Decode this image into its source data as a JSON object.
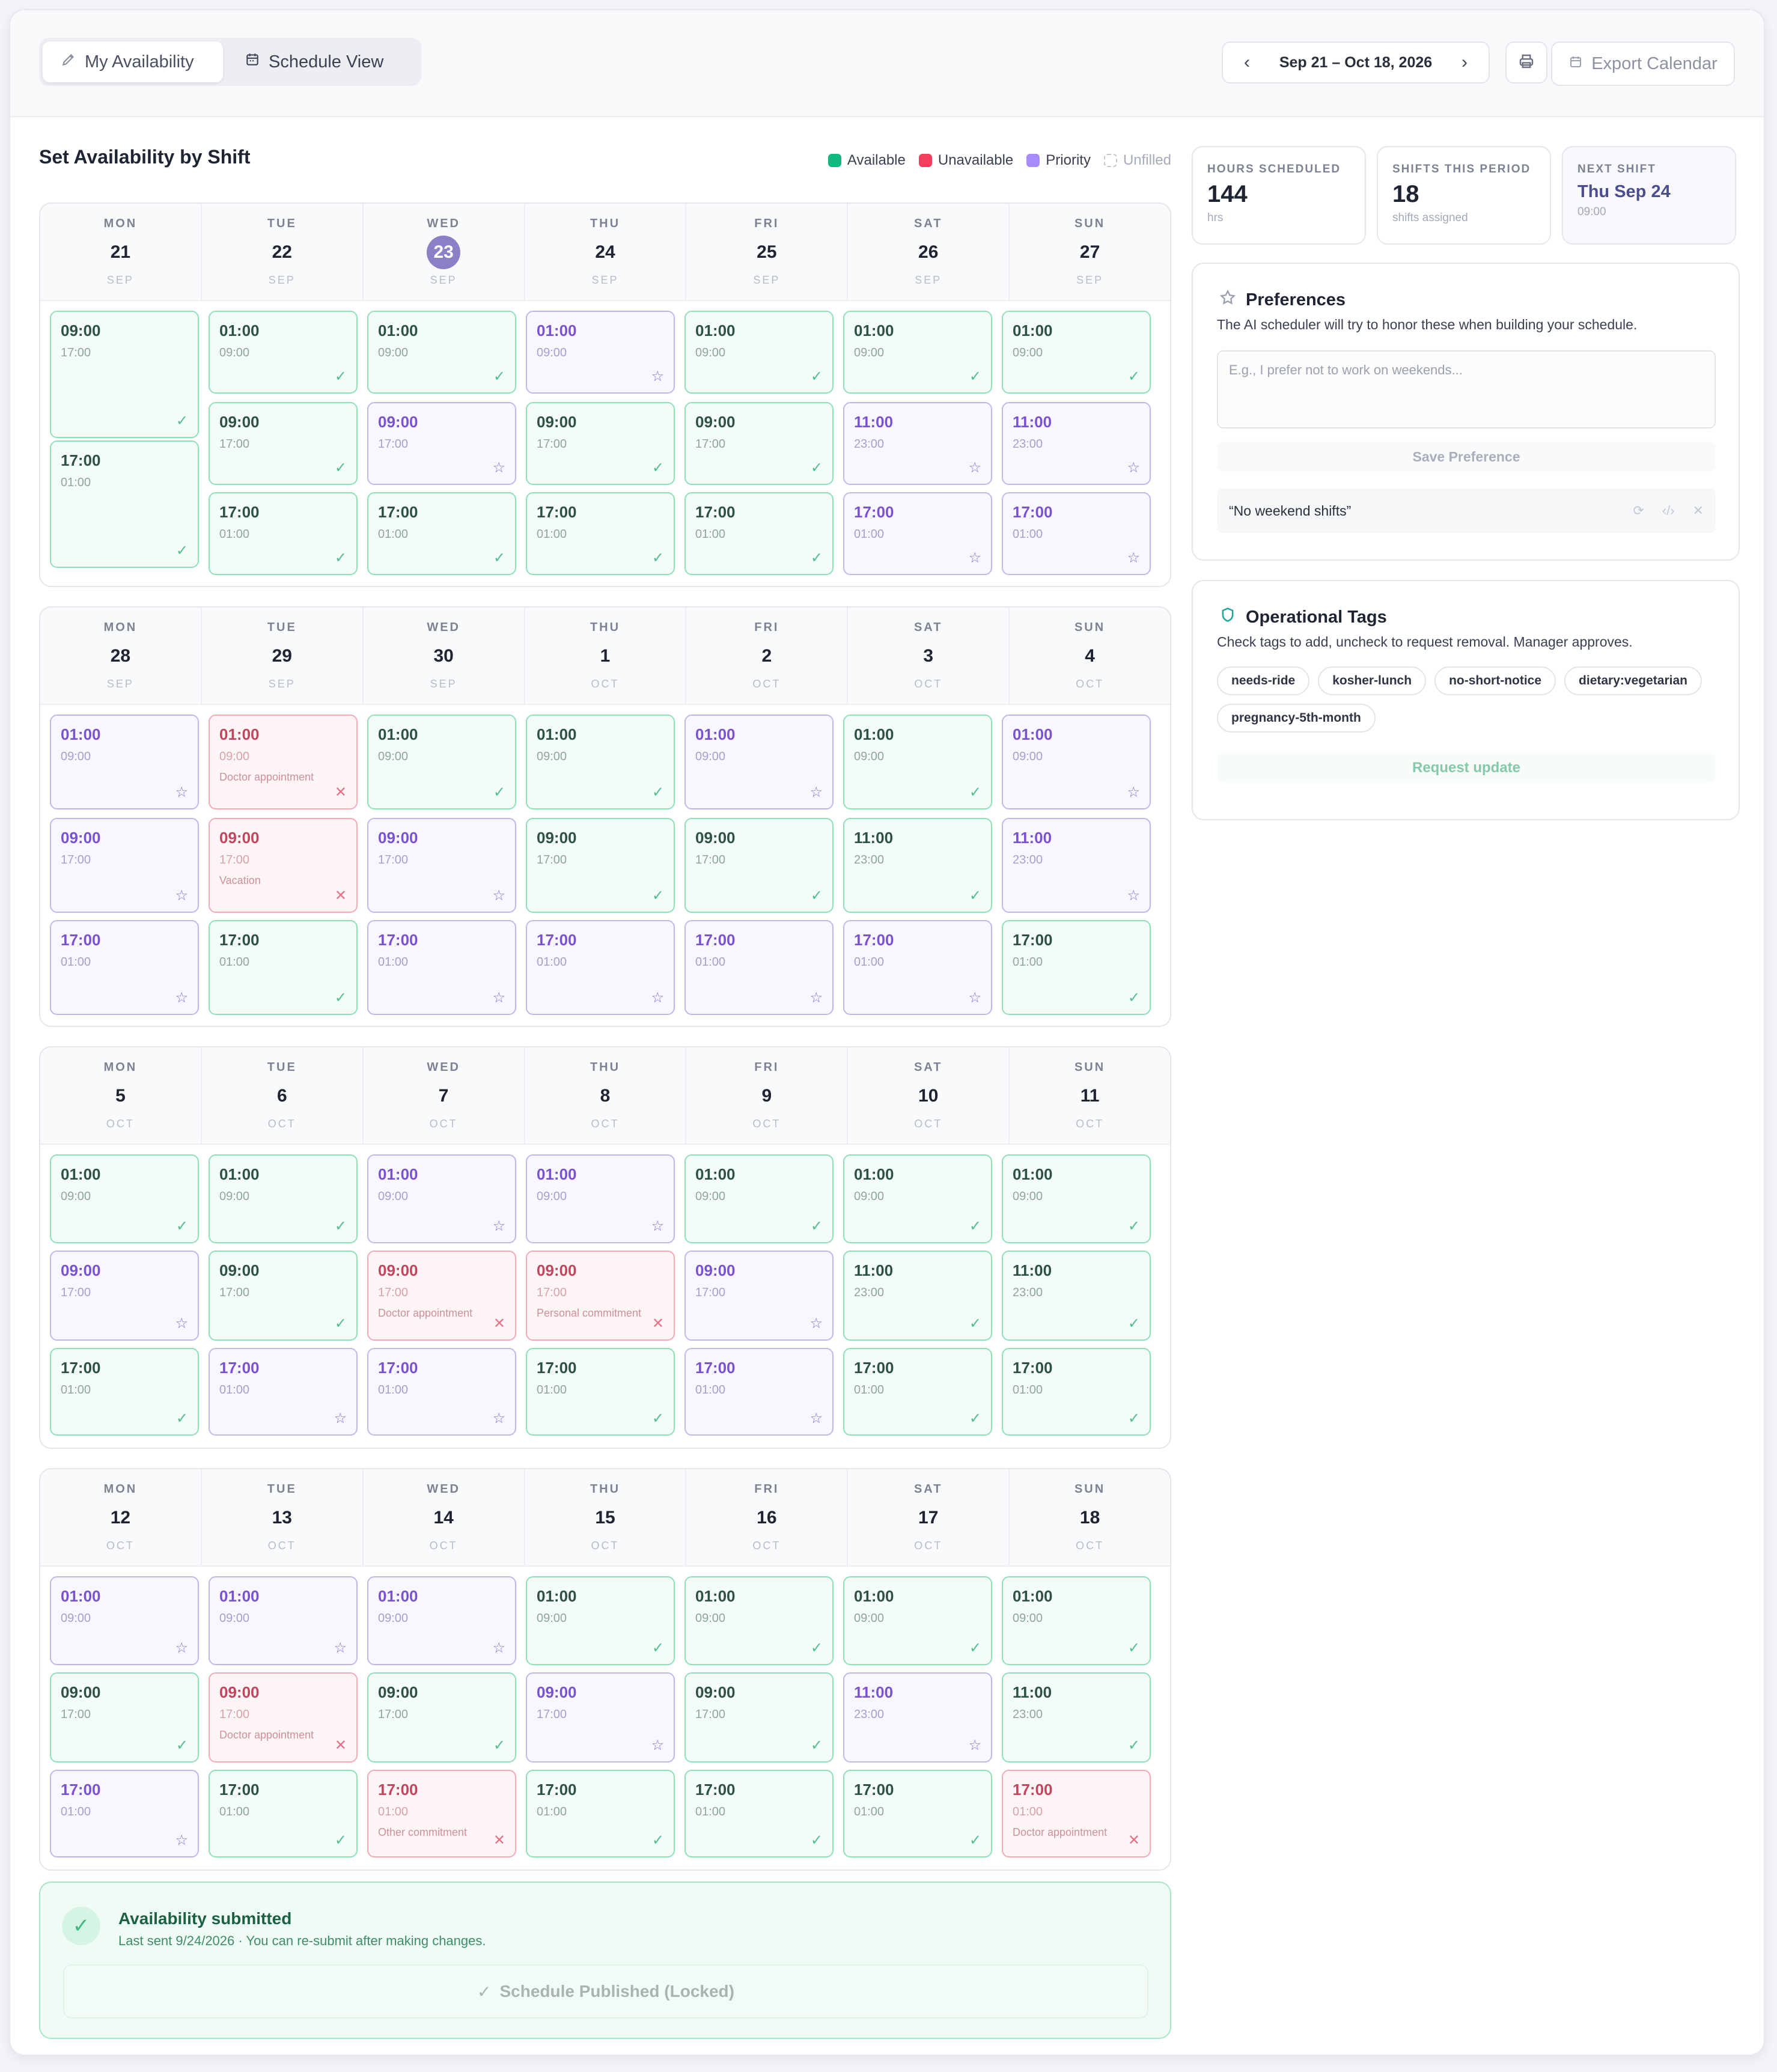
{
  "header": {
    "tabs": [
      {
        "label": "My Availability",
        "icon": "pencil-icon",
        "active": true
      },
      {
        "label": "Schedule View",
        "icon": "calendar-icon",
        "active": false
      }
    ],
    "date_range": "Sep 21 – Oct 18, 2026",
    "export_label": "Export Calendar"
  },
  "section_title": "Set Availability by Shift",
  "legend": [
    {
      "label": "Available",
      "color": "#10b981"
    },
    {
      "label": "Unavailable",
      "color": "#f43f5e"
    },
    {
      "label": "Priority",
      "color": "#a78bfa"
    },
    {
      "label": "Unfilled",
      "color": "#cbd5e1"
    }
  ],
  "weeks": [
    {
      "days": [
        {
          "dow": "MON",
          "day": "21",
          "mon": "SEP",
          "shifts": [
            {
              "start": "09:00",
              "end": "17:00",
              "status": "available"
            },
            {
              "start": "17:00",
              "end": "01:00",
              "status": "available"
            }
          ]
        },
        {
          "dow": "TUE",
          "day": "22",
          "mon": "SEP",
          "shifts": [
            {
              "start": "01:00",
              "end": "09:00",
              "status": "available"
            },
            {
              "start": "09:00",
              "end": "17:00",
              "status": "available"
            },
            {
              "start": "17:00",
              "end": "01:00",
              "status": "available"
            }
          ]
        },
        {
          "dow": "WED",
          "day": "23",
          "mon": "SEP",
          "today": true,
          "shifts": [
            {
              "start": "01:00",
              "end": "09:00",
              "status": "available"
            },
            {
              "start": "09:00",
              "end": "17:00",
              "status": "priority"
            },
            {
              "start": "17:00",
              "end": "01:00",
              "status": "available"
            }
          ]
        },
        {
          "dow": "THU",
          "day": "24",
          "mon": "SEP",
          "shifts": [
            {
              "start": "01:00",
              "end": "09:00",
              "status": "priority"
            },
            {
              "start": "09:00",
              "end": "17:00",
              "status": "available"
            },
            {
              "start": "17:00",
              "end": "01:00",
              "status": "available"
            }
          ]
        },
        {
          "dow": "FRI",
          "day": "25",
          "mon": "SEP",
          "shifts": [
            {
              "start": "01:00",
              "end": "09:00",
              "status": "available"
            },
            {
              "start": "09:00",
              "end": "17:00",
              "status": "available"
            },
            {
              "start": "17:00",
              "end": "01:00",
              "status": "available"
            }
          ]
        },
        {
          "dow": "SAT",
          "day": "26",
          "mon": "SEP",
          "shifts": [
            {
              "start": "01:00",
              "end": "09:00",
              "status": "available"
            },
            {
              "start": "11:00",
              "end": "23:00",
              "status": "priority"
            },
            {
              "start": "17:00",
              "end": "01:00",
              "status": "priority"
            }
          ]
        },
        {
          "dow": "SUN",
          "day": "27",
          "mon": "SEP",
          "shifts": [
            {
              "start": "01:00",
              "end": "09:00",
              "status": "available"
            },
            {
              "start": "11:00",
              "end": "23:00",
              "status": "priority"
            },
            {
              "start": "17:00",
              "end": "01:00",
              "status": "priority"
            }
          ]
        }
      ]
    },
    {
      "days": [
        {
          "dow": "MON",
          "day": "28",
          "mon": "SEP",
          "shifts": [
            {
              "start": "01:00",
              "end": "09:00",
              "status": "priority"
            },
            {
              "start": "09:00",
              "end": "17:00",
              "status": "priority"
            },
            {
              "start": "17:00",
              "end": "01:00",
              "status": "priority"
            }
          ]
        },
        {
          "dow": "TUE",
          "day": "29",
          "mon": "SEP",
          "shifts": [
            {
              "start": "01:00",
              "end": "09:00",
              "status": "unavailable",
              "note": "Doctor appointment"
            },
            {
              "start": "09:00",
              "end": "17:00",
              "status": "unavailable",
              "note": "Vacation"
            },
            {
              "start": "17:00",
              "end": "01:00",
              "status": "available"
            }
          ]
        },
        {
          "dow": "WED",
          "day": "30",
          "mon": "SEP",
          "shifts": [
            {
              "start": "01:00",
              "end": "09:00",
              "status": "available"
            },
            {
              "start": "09:00",
              "end": "17:00",
              "status": "priority"
            },
            {
              "start": "17:00",
              "end": "01:00",
              "status": "priority"
            }
          ]
        },
        {
          "dow": "THU",
          "day": "1",
          "mon": "OCT",
          "shifts": [
            {
              "start": "01:00",
              "end": "09:00",
              "status": "available"
            },
            {
              "start": "09:00",
              "end": "17:00",
              "status": "available"
            },
            {
              "start": "17:00",
              "end": "01:00",
              "status": "priority"
            }
          ]
        },
        {
          "dow": "FRI",
          "day": "2",
          "mon": "OCT",
          "shifts": [
            {
              "start": "01:00",
              "end": "09:00",
              "status": "priority"
            },
            {
              "start": "09:00",
              "end": "17:00",
              "status": "available"
            },
            {
              "start": "17:00",
              "end": "01:00",
              "status": "priority"
            }
          ]
        },
        {
          "dow": "SAT",
          "day": "3",
          "mon": "OCT",
          "shifts": [
            {
              "start": "01:00",
              "end": "09:00",
              "status": "available"
            },
            {
              "start": "11:00",
              "end": "23:00",
              "status": "available"
            },
            {
              "start": "17:00",
              "end": "01:00",
              "status": "priority"
            }
          ]
        },
        {
          "dow": "SUN",
          "day": "4",
          "mon": "OCT",
          "shifts": [
            {
              "start": "01:00",
              "end": "09:00",
              "status": "priority"
            },
            {
              "start": "11:00",
              "end": "23:00",
              "status": "priority"
            },
            {
              "start": "17:00",
              "end": "01:00",
              "status": "available"
            }
          ]
        }
      ]
    },
    {
      "days": [
        {
          "dow": "MON",
          "day": "5",
          "mon": "OCT",
          "shifts": [
            {
              "start": "01:00",
              "end": "09:00",
              "status": "available"
            },
            {
              "start": "09:00",
              "end": "17:00",
              "status": "priority"
            },
            {
              "start": "17:00",
              "end": "01:00",
              "status": "available"
            }
          ]
        },
        {
          "dow": "TUE",
          "day": "6",
          "mon": "OCT",
          "shifts": [
            {
              "start": "01:00",
              "end": "09:00",
              "status": "available"
            },
            {
              "start": "09:00",
              "end": "17:00",
              "status": "available"
            },
            {
              "start": "17:00",
              "end": "01:00",
              "status": "priority"
            }
          ]
        },
        {
          "dow": "WED",
          "day": "7",
          "mon": "OCT",
          "shifts": [
            {
              "start": "01:00",
              "end": "09:00",
              "status": "priority"
            },
            {
              "start": "09:00",
              "end": "17:00",
              "status": "unavailable",
              "note": "Doctor appointment"
            },
            {
              "start": "17:00",
              "end": "01:00",
              "status": "priority"
            }
          ]
        },
        {
          "dow": "THU",
          "day": "8",
          "mon": "OCT",
          "shifts": [
            {
              "start": "01:00",
              "end": "09:00",
              "status": "priority"
            },
            {
              "start": "09:00",
              "end": "17:00",
              "status": "unavailable",
              "note": "Personal commitment"
            },
            {
              "start": "17:00",
              "end": "01:00",
              "status": "available"
            }
          ]
        },
        {
          "dow": "FRI",
          "day": "9",
          "mon": "OCT",
          "shifts": [
            {
              "start": "01:00",
              "end": "09:00",
              "status": "available"
            },
            {
              "start": "09:00",
              "end": "17:00",
              "status": "priority"
            },
            {
              "start": "17:00",
              "end": "01:00",
              "status": "priority"
            }
          ]
        },
        {
          "dow": "SAT",
          "day": "10",
          "mon": "OCT",
          "shifts": [
            {
              "start": "01:00",
              "end": "09:00",
              "status": "available"
            },
            {
              "start": "11:00",
              "end": "23:00",
              "status": "available"
            },
            {
              "start": "17:00",
              "end": "01:00",
              "status": "available"
            }
          ]
        },
        {
          "dow": "SUN",
          "day": "11",
          "mon": "OCT",
          "shifts": [
            {
              "start": "01:00",
              "end": "09:00",
              "status": "available"
            },
            {
              "start": "11:00",
              "end": "23:00",
              "status": "available"
            },
            {
              "start": "17:00",
              "end": "01:00",
              "status": "available"
            }
          ]
        }
      ]
    },
    {
      "days": [
        {
          "dow": "MON",
          "day": "12",
          "mon": "OCT",
          "shifts": [
            {
              "start": "01:00",
              "end": "09:00",
              "status": "priority"
            },
            {
              "start": "09:00",
              "end": "17:00",
              "status": "available"
            },
            {
              "start": "17:00",
              "end": "01:00",
              "status": "priority"
            }
          ]
        },
        {
          "dow": "TUE",
          "day": "13",
          "mon": "OCT",
          "shifts": [
            {
              "start": "01:00",
              "end": "09:00",
              "status": "priority"
            },
            {
              "start": "09:00",
              "end": "17:00",
              "status": "unavailable",
              "note": "Doctor appointment"
            },
            {
              "start": "17:00",
              "end": "01:00",
              "status": "available"
            }
          ]
        },
        {
          "dow": "WED",
          "day": "14",
          "mon": "OCT",
          "shifts": [
            {
              "start": "01:00",
              "end": "09:00",
              "status": "priority"
            },
            {
              "start": "09:00",
              "end": "17:00",
              "status": "available"
            },
            {
              "start": "17:00",
              "end": "01:00",
              "status": "unavailable",
              "note": "Other commitment"
            }
          ]
        },
        {
          "dow": "THU",
          "day": "15",
          "mon": "OCT",
          "shifts": [
            {
              "start": "01:00",
              "end": "09:00",
              "status": "available"
            },
            {
              "start": "09:00",
              "end": "17:00",
              "status": "priority"
            },
            {
              "start": "17:00",
              "end": "01:00",
              "status": "available"
            }
          ]
        },
        {
          "dow": "FRI",
          "day": "16",
          "mon": "OCT",
          "shifts": [
            {
              "start": "01:00",
              "end": "09:00",
              "status": "available"
            },
            {
              "start": "09:00",
              "end": "17:00",
              "status": "available"
            },
            {
              "start": "17:00",
              "end": "01:00",
              "status": "available"
            }
          ]
        },
        {
          "dow": "SAT",
          "day": "17",
          "mon": "OCT",
          "shifts": [
            {
              "start": "01:00",
              "end": "09:00",
              "status": "available"
            },
            {
              "start": "11:00",
              "end": "23:00",
              "status": "priority"
            },
            {
              "start": "17:00",
              "end": "01:00",
              "status": "available"
            }
          ]
        },
        {
          "dow": "SUN",
          "day": "18",
          "mon": "OCT",
          "shifts": [
            {
              "start": "01:00",
              "end": "09:00",
              "status": "available"
            },
            {
              "start": "11:00",
              "end": "23:00",
              "status": "available"
            },
            {
              "start": "17:00",
              "end": "01:00",
              "status": "unavailable",
              "note": "Doctor appointment"
            }
          ]
        }
      ]
    }
  ],
  "submission": {
    "title": "Availability submitted",
    "text": "Last sent 9/24/2026 · You can re-submit after making changes.",
    "button": "Schedule Published (Locked)"
  },
  "stats": [
    {
      "label": "HOURS SCHEDULED",
      "value": "144",
      "sub": "hrs"
    },
    {
      "label": "SHIFTS THIS PERIOD",
      "value": "18",
      "sub": "shifts assigned"
    },
    {
      "label": "NEXT SHIFT",
      "value": "Thu Sep 24",
      "sub": "09:00"
    }
  ],
  "preferences": {
    "title": "Preferences",
    "desc": "The AI scheduler will try to honor these when building your schedule.",
    "placeholder": "E.g., I prefer not to work on weekends...",
    "save_label": "Save Preference",
    "items": [
      "“No weekend shifts”"
    ]
  },
  "tags_panel": {
    "title": "Operational Tags",
    "desc": "Check tags to add, uncheck to request removal. Manager approves.",
    "tags": [
      "needs-ride",
      "kosher-lunch",
      "no-short-notice",
      "dietary:vegetarian",
      "pregnancy-5th-month"
    ],
    "request_label": "Request update"
  }
}
